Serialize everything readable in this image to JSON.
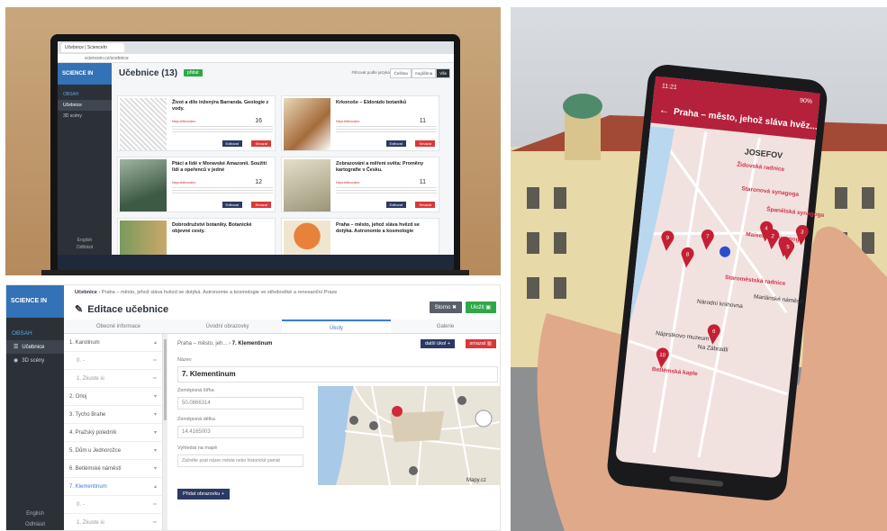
{
  "laptop": {
    "tab_title": "Učebnice | ScienceIn",
    "url": "sciencein.cz/ucebnice",
    "brand": "SCIENCE IN",
    "sidebar_heading": "OBSAH",
    "sidebar_items": [
      "Učebnice",
      "3D scény"
    ],
    "sidebar_footer": [
      "English",
      "Odhlásit"
    ],
    "page_title": "Učebnice (13)",
    "add_label": "přidat",
    "filter_label": "Filtrovat podle jazyka:",
    "filter_options": [
      "Čeština",
      "Angličtina",
      "Vše"
    ],
    "cards": [
      {
        "title": "Život a dílo inženýra Barranda. Geologie z vody.",
        "status": "Nepublikováno",
        "count": "16",
        "edit": "Editovat",
        "delete": "Smazat"
      },
      {
        "title": "Krkonoše – Eldorádo botaniků",
        "status": "Nepublikováno",
        "count": "11",
        "edit": "Editovat",
        "delete": "Smazat"
      },
      {
        "title": "Ptáci a lidé v Moravské Amazonii. Soužití lidí a opeřenců v jedné",
        "status": "Nepublikováno",
        "count": "12",
        "edit": "Editovat",
        "delete": "Smazat"
      },
      {
        "title": "Zobrazování a měření světa: Proměny kartografie v Česku.",
        "status": "Nepublikováno",
        "count": "11",
        "edit": "Editovat",
        "delete": "Smazat"
      },
      {
        "title": "Dobrodružství botaniky. Botanické objevné cesty.",
        "status": "",
        "count": "",
        "edit": "",
        "delete": ""
      },
      {
        "title": "Praha – město, jehož sláva hvězd se dotýká. Astronomie a kosmologie",
        "status": "",
        "count": "",
        "edit": "",
        "delete": ""
      }
    ]
  },
  "editor": {
    "brand": "SCIENCE IN",
    "sidebar_heading": "OBSAH",
    "sidebar_items": [
      "Učebnice",
      "3D scény"
    ],
    "sidebar_footer": [
      "English",
      "Odhlásit"
    ],
    "breadcrumb_root": "Učebnice",
    "breadcrumb_rest": "›  Praha – město, jehož sláva hvězd se dotýká. Astronomie a kosmologie ve středověké a renesanční Praze",
    "title": "Editace učebnice",
    "storno": "Storno",
    "save": "Uložit",
    "tabs": [
      "Obecné informace",
      "Úvodní obrazovky",
      "Úkoly",
      "Galerie"
    ],
    "task_list": [
      {
        "label": "1. Karolinum",
        "sub": false
      },
      {
        "label": "0. -",
        "sub": true
      },
      {
        "label": "1. Zkuste si",
        "sub": true
      },
      {
        "label": "2. Orloj",
        "sub": false
      },
      {
        "label": "3. Tycho Brahe",
        "sub": false
      },
      {
        "label": "4. Pražský poledník",
        "sub": false
      },
      {
        "label": "5. Dům u Jednorožce",
        "sub": false
      },
      {
        "label": "6. Betlémské náměstí",
        "sub": false
      },
      {
        "label": "7. Klementinum",
        "sub": false
      },
      {
        "label": "0. -",
        "sub": true
      },
      {
        "label": "1. Zkuste si",
        "sub": true
      }
    ],
    "detail_breadcrumb_root": "Praha – město, jeh...",
    "detail_breadcrumb_current": "7. Klementinum",
    "next_label": "další úkol",
    "delete_label": "smazat",
    "name_label": "Název",
    "name_value": "7. Klementinum",
    "lat_label": "Zeměpisná šířka",
    "lat_value": "50.0866314",
    "lon_label": "Zeměpisná délka",
    "lon_value": "14.4165003",
    "search_label": "Vyhledat na mapě",
    "search_placeholder": "Začněte psát název města nebo historické památ",
    "add_image_label": "Přidat obrazovku",
    "map_watermark": "Mapy.cz"
  },
  "phone": {
    "status_time": "11:21",
    "status_battery": "90%",
    "header_title": "Praha – město, jehož sláva hvěz...",
    "map_labels": [
      "JOSEFOV",
      "Židovská radnice",
      "Staronová synagoga",
      "Španělská synagoga",
      "Maiselova synagoga",
      "Staroměstská radnice",
      "Národní knihovna",
      "Mariánské náměstí",
      "Náprstkovo muzeum",
      "Betlémská kaple",
      "Na Zábradlí"
    ],
    "pin_numbers": [
      "1",
      "2",
      "3",
      "4",
      "5",
      "6",
      "7",
      "8",
      "9",
      "10"
    ]
  },
  "colors": {
    "sidebar": "#2c3138",
    "brand": "#3372b7",
    "accent": "#3a7bd5",
    "success": "#2ea84a",
    "danger": "#d9383a",
    "navy": "#2b3a63",
    "phone_header": "#b5203a"
  }
}
